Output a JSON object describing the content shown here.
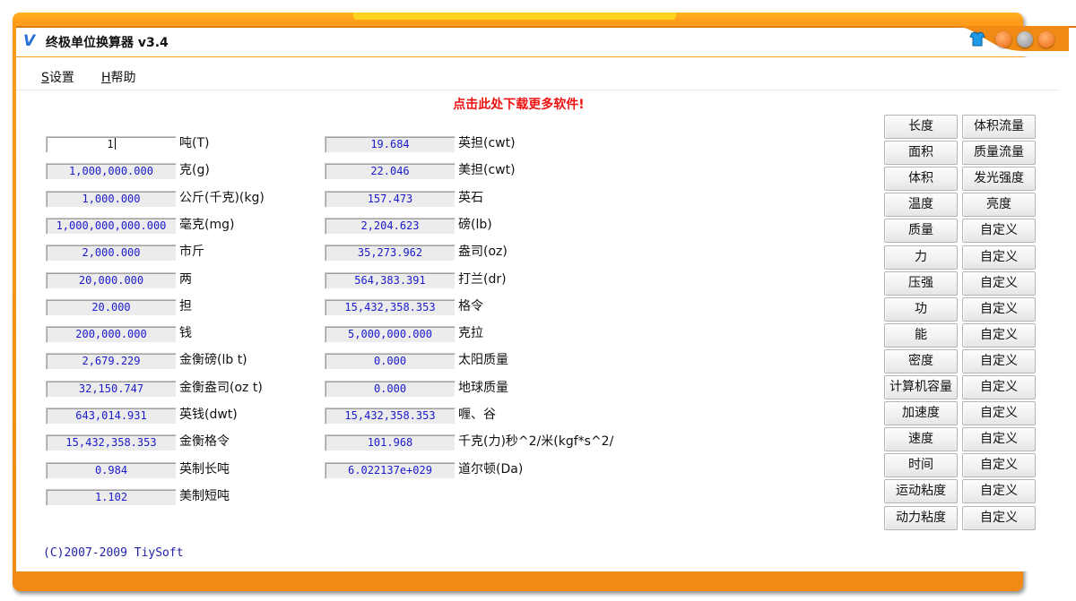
{
  "window": {
    "title": "终极单位换算器 v3.4"
  },
  "menu": {
    "settings_key": "S",
    "settings_label": "设置",
    "help_key": "H",
    "help_label": "帮助"
  },
  "promo_link": "点击此处下载更多软件!",
  "units_left": [
    {
      "value": "1",
      "unit": "吨(T)"
    },
    {
      "value": "1,000,000.000",
      "unit": "克(g)"
    },
    {
      "value": "1,000.000",
      "unit": "公斤(千克)(kg)"
    },
    {
      "value": "1,000,000,000.000",
      "unit": "毫克(mg)"
    },
    {
      "value": "2,000.000",
      "unit": "市斤"
    },
    {
      "value": "20,000.000",
      "unit": "两"
    },
    {
      "value": "20.000",
      "unit": "担"
    },
    {
      "value": "200,000.000",
      "unit": "钱"
    },
    {
      "value": "2,679.229",
      "unit": "金衡磅(lb t)"
    },
    {
      "value": "32,150.747",
      "unit": "金衡盎司(oz t)"
    },
    {
      "value": "643,014.931",
      "unit": "英钱(dwt)"
    },
    {
      "value": "15,432,358.353",
      "unit": "金衡格令"
    },
    {
      "value": "0.984",
      "unit": "英制长吨"
    },
    {
      "value": "1.102",
      "unit": "美制短吨"
    }
  ],
  "units_right": [
    {
      "value": "19.684",
      "unit": "英担(cwt)"
    },
    {
      "value": "22.046",
      "unit": "美担(cwt)"
    },
    {
      "value": "157.473",
      "unit": "英石"
    },
    {
      "value": "2,204.623",
      "unit": "磅(lb)"
    },
    {
      "value": "35,273.962",
      "unit": "盎司(oz)"
    },
    {
      "value": "564,383.391",
      "unit": "打兰(dr)"
    },
    {
      "value": "15,432,358.353",
      "unit": "格令"
    },
    {
      "value": "5,000,000.000",
      "unit": "克拉"
    },
    {
      "value": "0.000",
      "unit": "太阳质量"
    },
    {
      "value": "0.000",
      "unit": "地球质量"
    },
    {
      "value": "15,432,358.353",
      "unit": "喱、谷"
    },
    {
      "value": "101.968",
      "unit": "千克(力)秒^2/米(kgf*s^2/"
    },
    {
      "value": "6.022137e+029",
      "unit": "道尔顿(Da)"
    }
  ],
  "categories_col1": [
    "长度",
    "面积",
    "体积",
    "温度",
    "质量",
    "力",
    "压强",
    "功",
    "能",
    "密度",
    "计算机容量",
    "加速度",
    "速度",
    "时间",
    "运动粘度",
    "动力粘度"
  ],
  "categories_col2": [
    "体积流量",
    "质量流量",
    "发光强度",
    "亮度",
    "自定义",
    "自定义",
    "自定义",
    "自定义",
    "自定义",
    "自定义",
    "自定义",
    "自定义",
    "自定义",
    "自定义",
    "自定义",
    "自定义"
  ],
  "copyright": "(C)2007-2009 TiySoft",
  "colors": {
    "frame": "#f08a14",
    "value_text": "#1a1acc",
    "promo": "#ee1111",
    "copyright": "#2222aa"
  }
}
